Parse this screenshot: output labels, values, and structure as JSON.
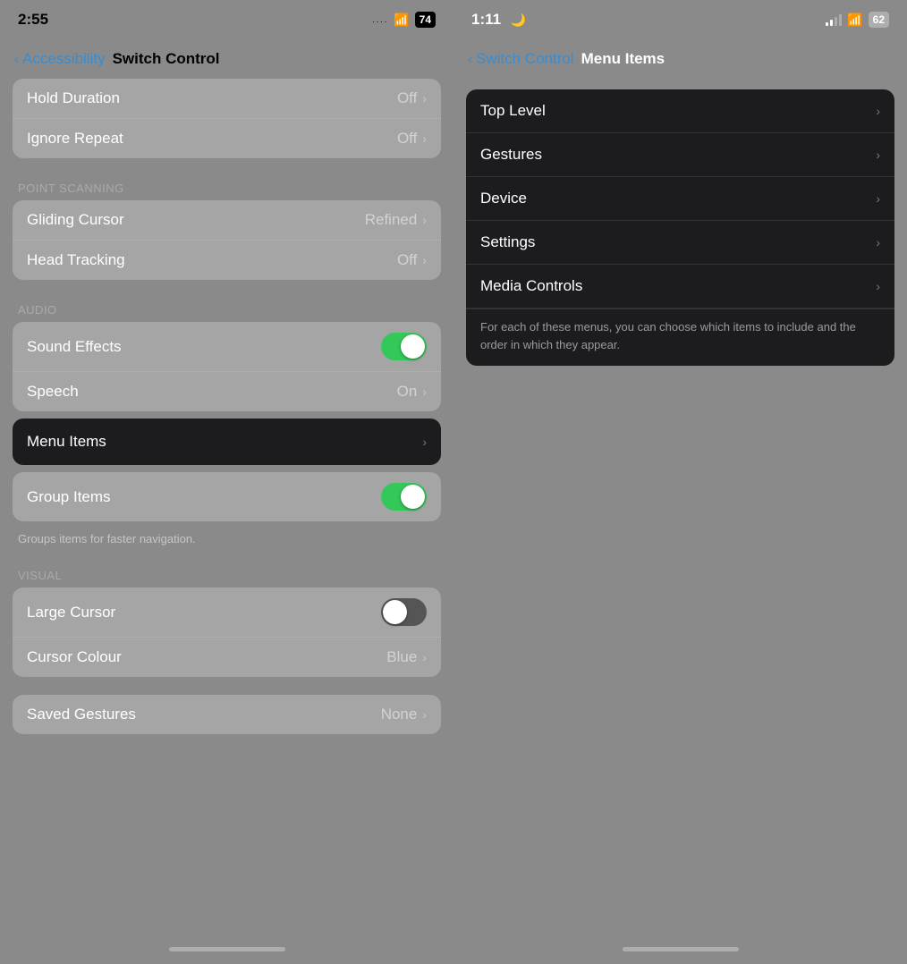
{
  "left": {
    "status": {
      "time": "2:55",
      "dots": "....",
      "wifi": "WiFi",
      "battery": "74"
    },
    "nav": {
      "back_label": "Accessibility",
      "title": "Switch Control"
    },
    "rows_top": [
      {
        "label": "Hold Duration",
        "value": "Off",
        "has_chevron": true
      },
      {
        "label": "Ignore Repeat",
        "value": "Off",
        "has_chevron": true
      }
    ],
    "section_point": "POINT SCANNING",
    "rows_point": [
      {
        "label": "Gliding Cursor",
        "value": "Refined",
        "has_chevron": true
      },
      {
        "label": "Head Tracking",
        "value": "Off",
        "has_chevron": true
      }
    ],
    "section_audio": "AUDIO",
    "rows_audio": [
      {
        "label": "Sound Effects",
        "toggle": true,
        "toggle_on": true
      },
      {
        "label": "Speech",
        "value": "On",
        "has_chevron": true
      }
    ],
    "menu_items": {
      "label": "Menu Items",
      "has_chevron": true
    },
    "rows_group": [
      {
        "label": "Group Items",
        "toggle": true,
        "toggle_on": true
      }
    ],
    "helper_group": "Groups items for faster navigation.",
    "section_visual": "VISUAL",
    "rows_visual": [
      {
        "label": "Large Cursor",
        "toggle": true,
        "toggle_on": false
      },
      {
        "label": "Cursor Colour",
        "value": "Blue",
        "has_chevron": true
      }
    ],
    "rows_saved": [
      {
        "label": "Saved Gestures",
        "value": "None",
        "has_chevron": true
      }
    ]
  },
  "right": {
    "status": {
      "time": "1:11",
      "moon": "🌙",
      "signal": "signal",
      "wifi": "WiFi",
      "battery": "62"
    },
    "nav": {
      "back_label": "Switch Control",
      "title": "Menu Items"
    },
    "menu_items": [
      {
        "label": "Top Level",
        "has_chevron": true
      },
      {
        "label": "Gestures",
        "has_chevron": true
      },
      {
        "label": "Device",
        "has_chevron": true
      },
      {
        "label": "Settings",
        "has_chevron": true
      },
      {
        "label": "Media Controls",
        "has_chevron": true
      }
    ],
    "description": "For each of these menus, you can choose which items to include and the order in which they appear."
  }
}
